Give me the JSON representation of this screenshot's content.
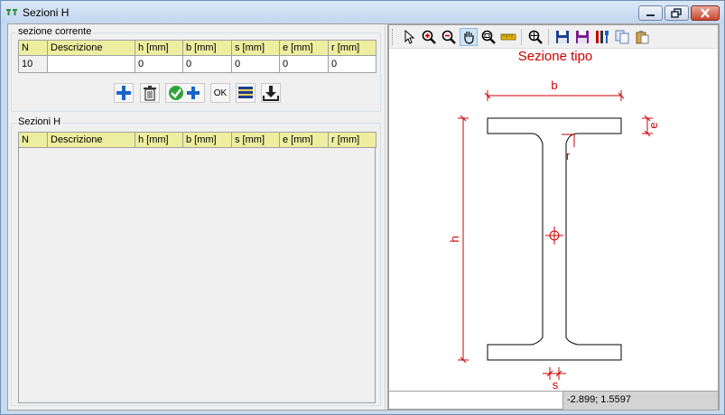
{
  "window": {
    "title": "Sezioni H"
  },
  "current_section": {
    "group_label": "sezione corrente",
    "columns": [
      "N",
      "Descrizione",
      "h [mm]",
      "b [mm]",
      "s [mm]",
      "e [mm]",
      "r [mm]"
    ],
    "row": [
      "10",
      "",
      "0",
      "0",
      "0",
      "0",
      "0"
    ]
  },
  "actions": {
    "add_icon": "plus-icon",
    "delete_icon": "trash-icon",
    "confirm_add_icon": "check-plus-icon",
    "ok_label": "OK",
    "list_icon": "list-icon",
    "download_icon": "download-icon"
  },
  "sections_list": {
    "group_label": "Sezioni H",
    "columns": [
      "N",
      "Descrizione",
      "h [mm]",
      "b [mm]",
      "s [mm]",
      "e [mm]",
      "r [mm]"
    ],
    "rows": []
  },
  "toolbar": {
    "icons": [
      "pointer-icon",
      "zoom-in-icon",
      "zoom-out-icon",
      "pan-hand-icon",
      "zoom-window-icon",
      "measure-icon",
      "zoom-extents-icon",
      "save-icon",
      "save-as-icon",
      "tools-icon",
      "copy-icon",
      "paste-icon"
    ]
  },
  "drawing": {
    "title": "Sezione tipo",
    "dimension_labels": {
      "width": "b",
      "height": "h",
      "flange": "e",
      "radius": "r",
      "web": "s"
    },
    "line_color": "#000000",
    "dimension_color": "#cc0000"
  },
  "status": {
    "coordinates": "-2.899; 1.5597"
  }
}
